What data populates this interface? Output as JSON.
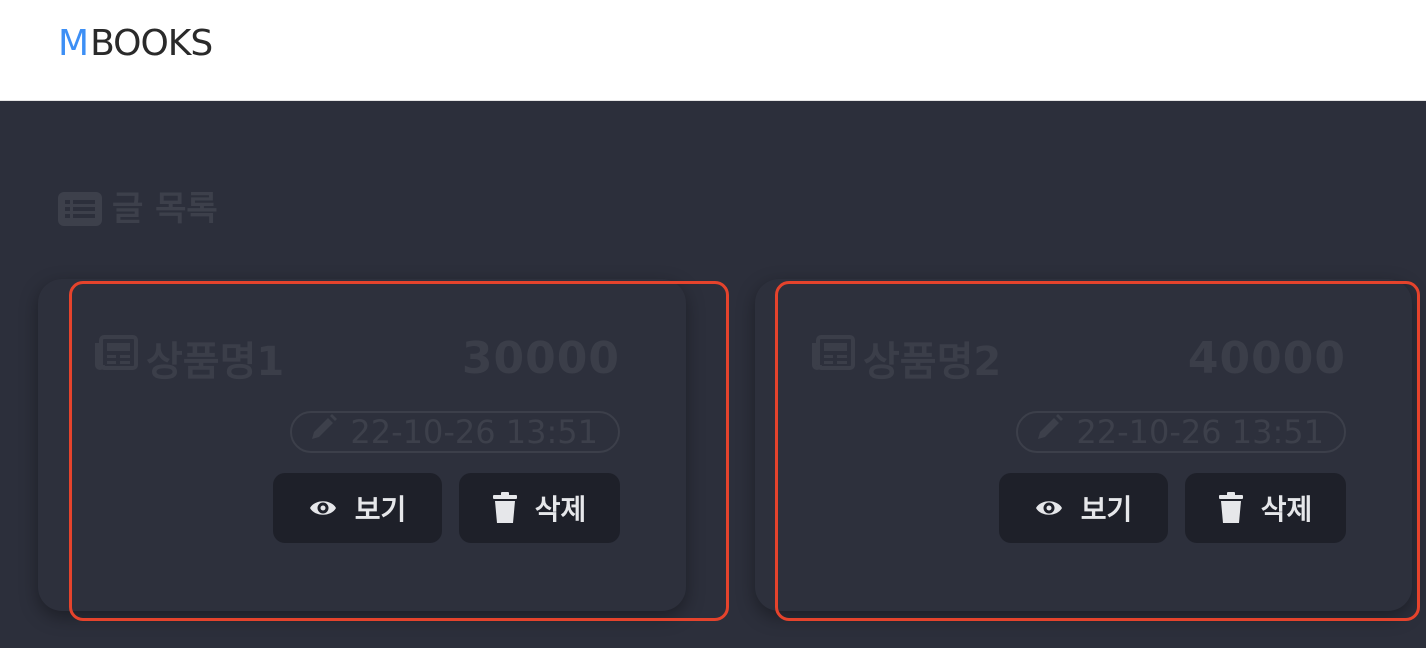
{
  "header": {
    "logo_m": "M",
    "logo_rest": "BOOKS",
    "accent_color": "#3d8ff5"
  },
  "main": {
    "section_icon": "list-icon",
    "section_title": "글 목록",
    "cards": [
      {
        "icon": "newspaper-icon",
        "name": "상품명1",
        "price": "30000",
        "date_icon": "pencil-icon",
        "date": "22-10-26 13:51",
        "view_icon": "eye-icon",
        "view_label": "보기",
        "delete_icon": "trash-icon",
        "delete_label": "삭제"
      },
      {
        "icon": "newspaper-icon",
        "name": "상품명2",
        "price": "40000",
        "date_icon": "pencil-icon",
        "date": "22-10-26 13:51",
        "view_icon": "eye-icon",
        "view_label": "보기",
        "delete_icon": "trash-icon",
        "delete_label": "삭제"
      }
    ],
    "highlight_color": "#e5432c"
  }
}
